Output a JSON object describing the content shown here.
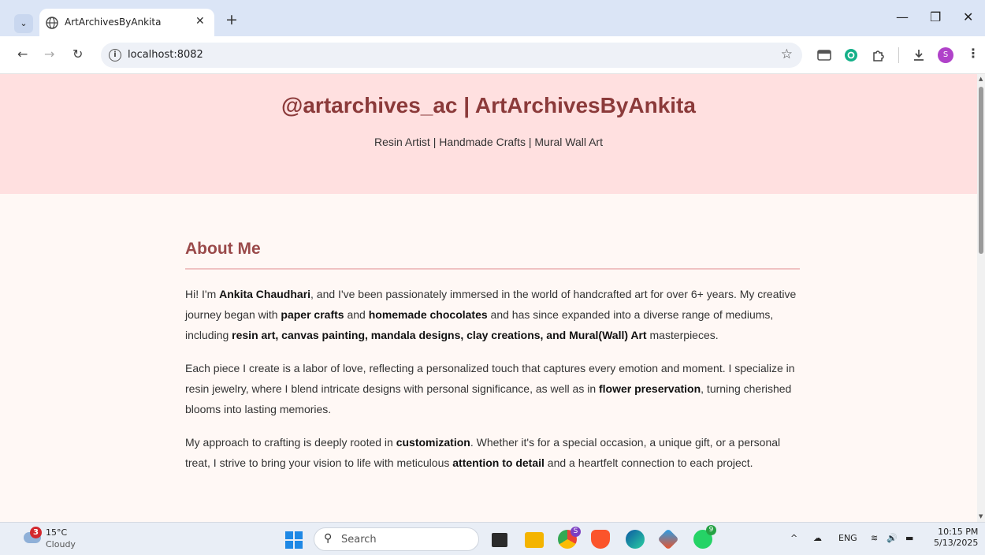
{
  "browser": {
    "tab_title": "ArtArchivesByAnkita",
    "url": "localhost:8082",
    "avatar_letter": "S"
  },
  "page": {
    "hero_title": "@artarchives_ac | ArtArchivesByAnkita",
    "hero_subtitle": "Resin Artist | Handmade Crafts | Mural Wall Art",
    "about_heading": "About Me",
    "p1": {
      "t1": "Hi! I'm ",
      "b1": "Ankita Chaudhari",
      "t2": ", and I've been passionately immersed in the world of handcrafted art for over 6+ years. My creative journey began with ",
      "b2": "paper crafts",
      "t3": " and ",
      "b3": "homemade chocolates",
      "t4": " and has since expanded into a diverse range of mediums, including ",
      "b4": "resin art, canvas painting, mandala designs, clay creations, and Mural(Wall) Art",
      "t5": " masterpieces."
    },
    "p2": {
      "t1": "Each piece I create is a labor of love, reflecting a personalized touch that captures every emotion and moment. I specialize in resin jewelry, where I blend intricate designs with personal significance, as well as in ",
      "b1": "flower preservation",
      "t2": ", turning cherished blooms into lasting memories."
    },
    "p3": {
      "t1": "My approach to crafting is deeply rooted in ",
      "b1": "customization",
      "t2": ". Whether it's for a special occasion, a unique gift, or a personal treat, I strive to bring your vision to life with meticulous ",
      "b2": "attention to detail",
      "t3": " and a heartfelt connection to each project."
    }
  },
  "taskbar": {
    "weather_badge": "3",
    "temperature": "15°C",
    "condition": "Cloudy",
    "search_label": "Search",
    "chrome_badge": "S",
    "whatsapp_badge": "9",
    "language": "ENG",
    "time": "10:15 PM",
    "date": "5/13/2025"
  }
}
